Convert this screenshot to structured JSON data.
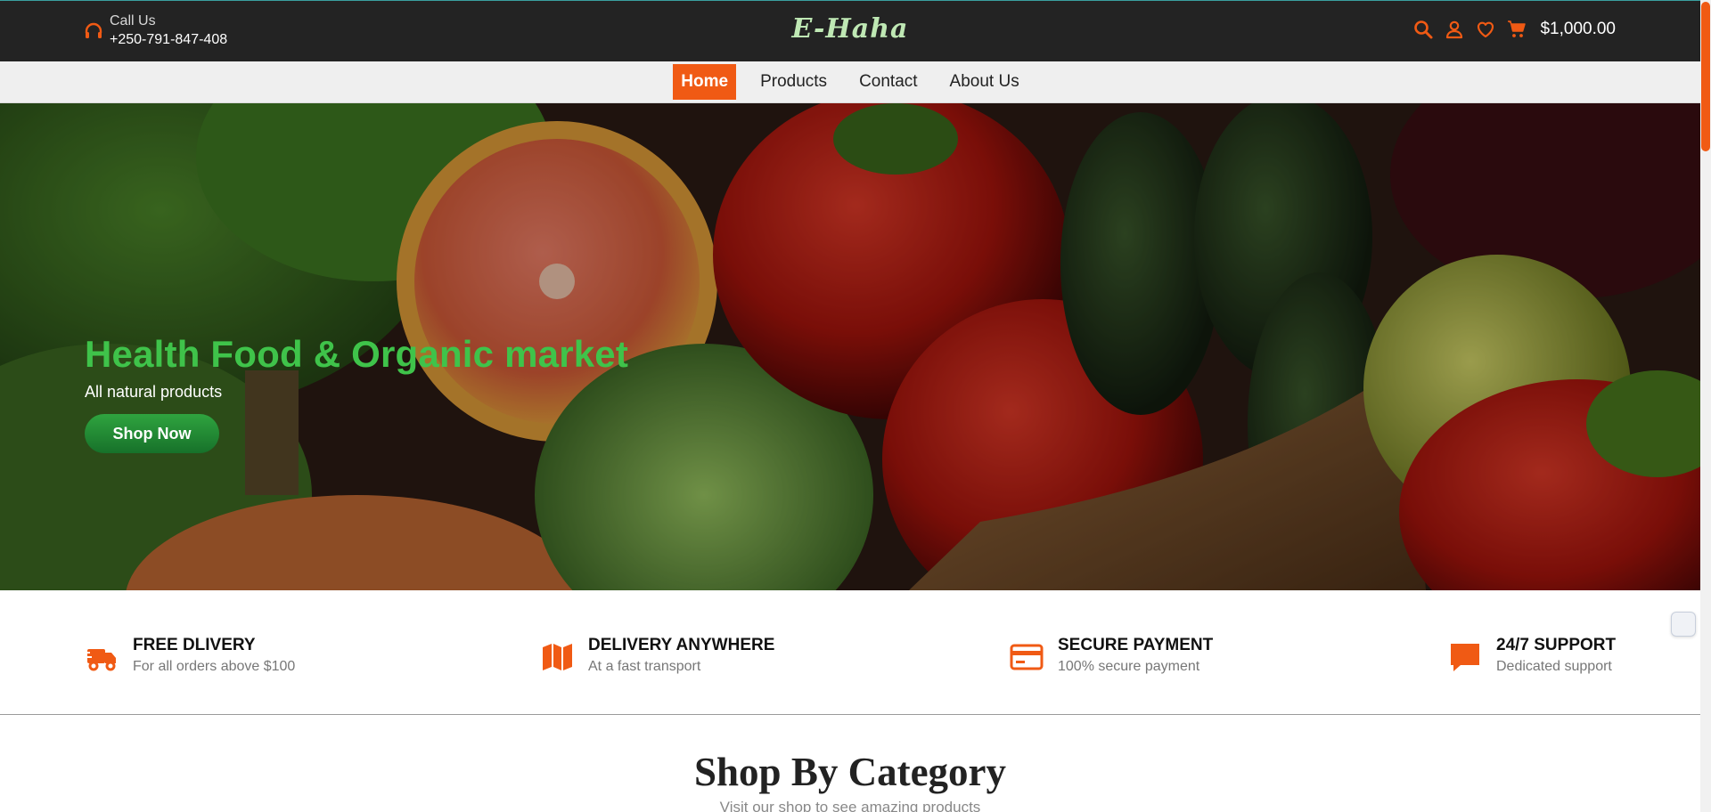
{
  "header": {
    "call_label": "Call Us",
    "phone": "+250-791-847-408",
    "logo": "E-Haha",
    "cart_total": "$1,000.00",
    "icons": [
      "headset-icon",
      "search-icon",
      "user-icon",
      "heart-icon",
      "cart-icon"
    ]
  },
  "nav": {
    "items": [
      {
        "label": "Home",
        "active": true
      },
      {
        "label": "Products",
        "active": false
      },
      {
        "label": "Contact",
        "active": false
      },
      {
        "label": "About Us",
        "active": false
      }
    ]
  },
  "hero": {
    "title": "Health Food & Organic market",
    "subtitle": "All natural products",
    "button": "Shop Now"
  },
  "features": [
    {
      "icon": "truck-icon",
      "title": "FREE DLIVERY",
      "subtitle": "For all orders above $100"
    },
    {
      "icon": "map-icon",
      "title": "DELIVERY ANYWHERE",
      "subtitle": "At a fast transport"
    },
    {
      "icon": "credit-card-icon",
      "title": "SECURE PAYMENT",
      "subtitle": "100% secure payment"
    },
    {
      "icon": "chat-icon",
      "title": "24/7 SUPPORT",
      "subtitle": "Dedicated support"
    }
  ],
  "category": {
    "title": "Shop By Category",
    "subtitle": "Visit our shop to see amazing products"
  },
  "colors": {
    "accent": "#f05a14",
    "hero_title": "#3fc34a",
    "topbar": "#232323",
    "logo": "#bfe8b4",
    "button_green": "#2fa43f"
  }
}
